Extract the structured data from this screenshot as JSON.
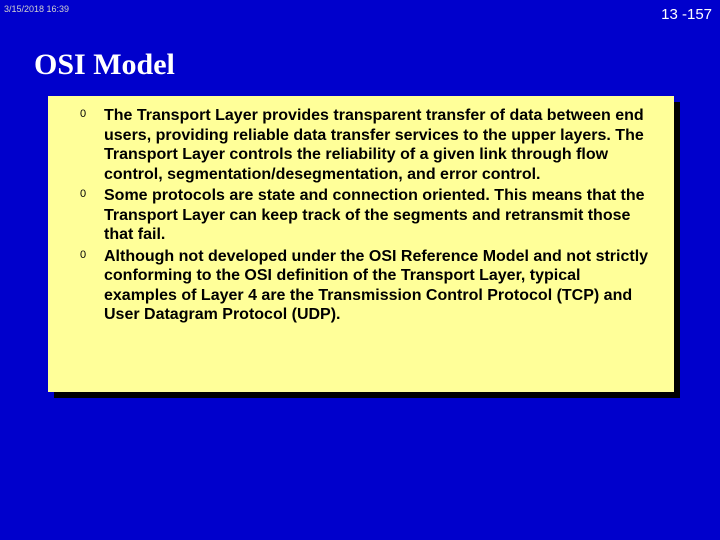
{
  "header": {
    "timestamp": "3/15/2018  16:39",
    "page_number": "13 -157"
  },
  "title": "OSI Model",
  "bullets": {
    "marker": "0",
    "items": [
      "The Transport Layer provides transparent transfer of data between end users, providing reliable data transfer services to the upper layers. The Transport Layer controls the reliability of a given link through flow control, segmentation/desegmentation, and error control.",
      "Some protocols are state and connection oriented. This means that the Transport Layer can keep track of the segments and retransmit those that fail.",
      "Although not developed under the OSI Reference Model and not strictly conforming to the OSI definition of the Transport Layer, typical examples of Layer 4 are the Transmission Control Protocol (TCP) and User Datagram Protocol (UDP)."
    ]
  }
}
